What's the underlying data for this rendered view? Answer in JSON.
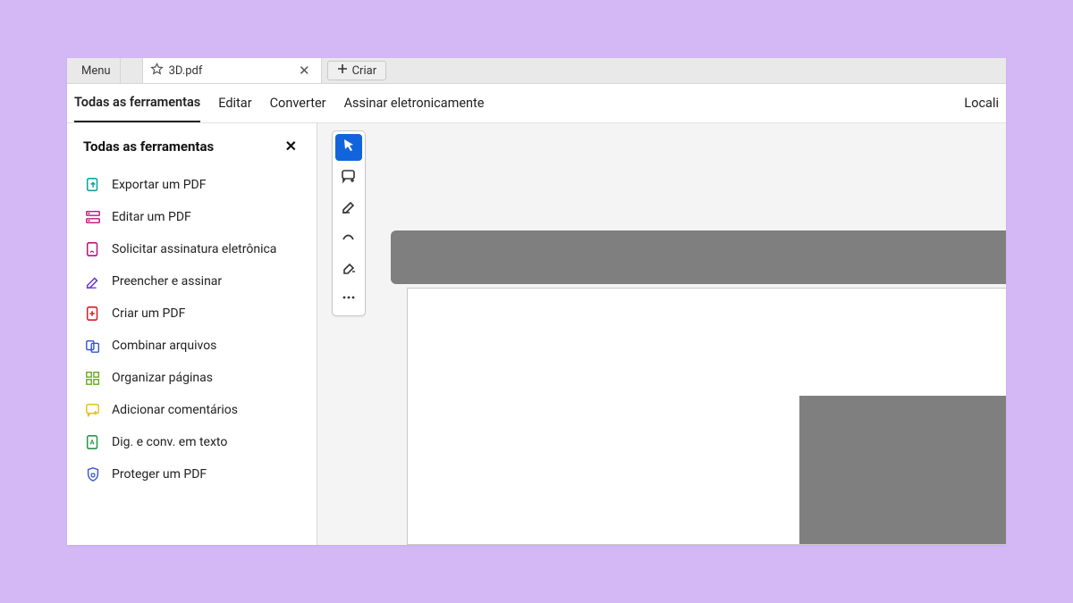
{
  "titlebar": {
    "menu_label": "Menu",
    "tab_title": "3D.pdf",
    "new_tab_label": "Criar"
  },
  "menubar": {
    "items": [
      "Todas as ferramentas",
      "Editar",
      "Converter",
      "Assinar eletronicamente"
    ],
    "right_item": "Locali"
  },
  "sidebar": {
    "title": "Todas as ferramentas",
    "tools": [
      {
        "label": "Exportar um PDF"
      },
      {
        "label": "Editar um PDF"
      },
      {
        "label": "Solicitar assinatura eletrônica"
      },
      {
        "label": "Preencher e assinar"
      },
      {
        "label": "Criar um PDF"
      },
      {
        "label": "Combinar arquivos"
      },
      {
        "label": "Organizar páginas"
      },
      {
        "label": "Adicionar comentários"
      },
      {
        "label": "Dig. e conv. em texto"
      },
      {
        "label": "Proteger um PDF"
      }
    ]
  },
  "colors": {
    "accent": "#1264dd",
    "teal": "#0aa3a3",
    "magenta": "#c1127b",
    "purple": "#6a3bcf",
    "red": "#d81e28",
    "blue": "#3956d1",
    "green": "#63a615",
    "yellow": "#e6c02a"
  }
}
